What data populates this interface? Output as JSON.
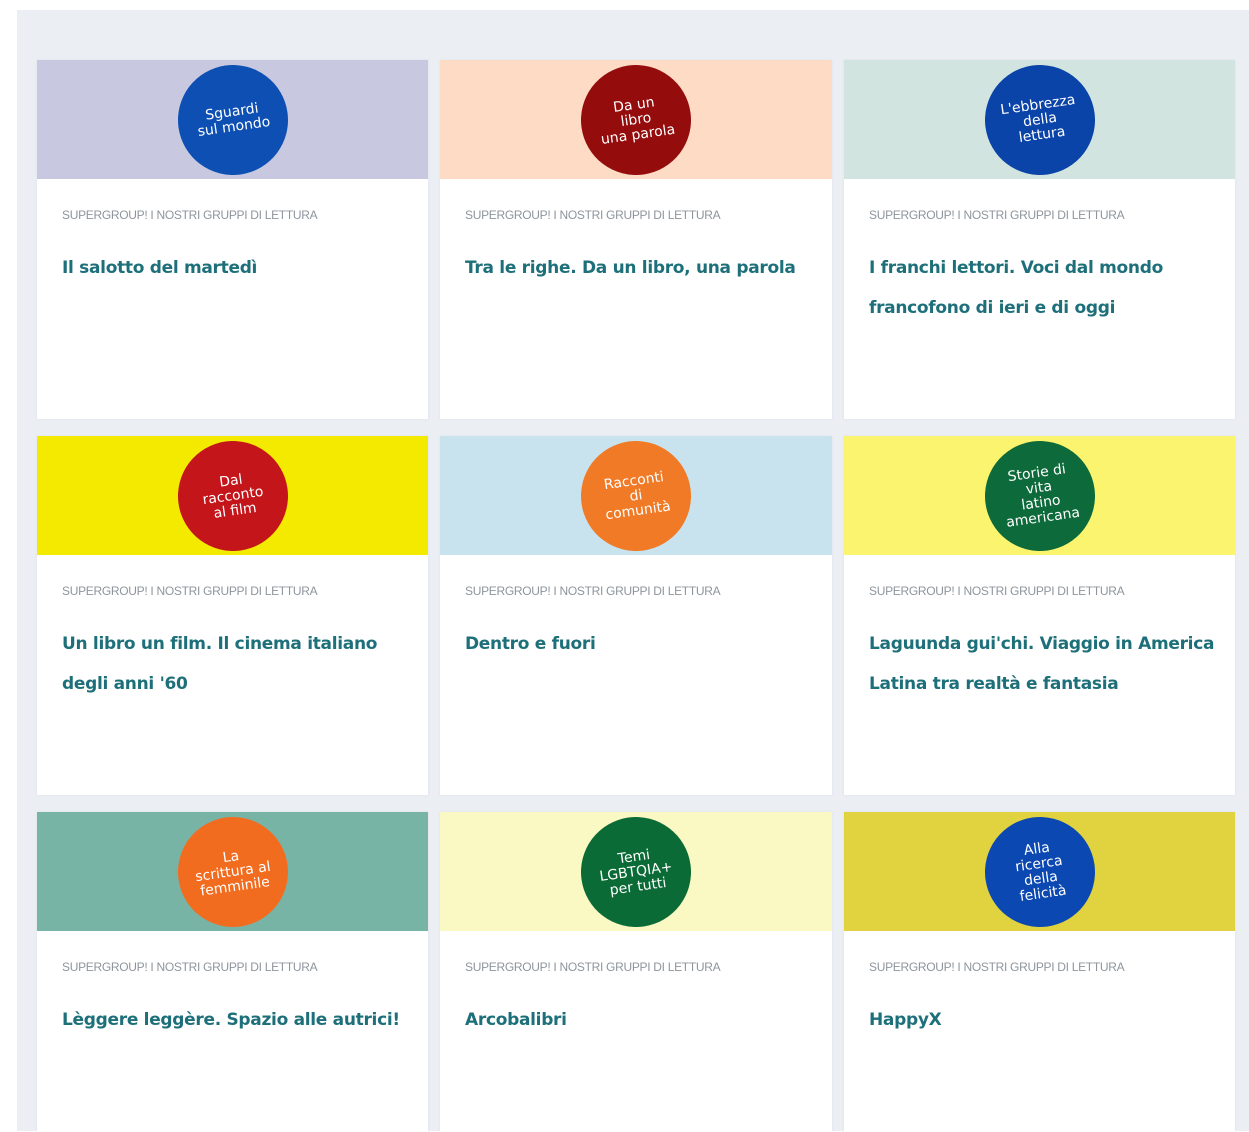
{
  "cards": [
    {
      "category": "SUPERGROUP! I NOSTRI GRUPPI DI LETTURA",
      "title": "Il salotto del martedì",
      "badge_text": "Sguardi\nsul mondo",
      "banner_color": "#c8c8e0",
      "badge_color": "#0e4fb3"
    },
    {
      "category": "SUPERGROUP! I NOSTRI GRUPPI DI LETTURA",
      "title": "Tra le righe. Da un libro, una parola",
      "badge_text": "Da un\nlibro\nuna parola",
      "banner_color": "#fedbc4",
      "badge_color": "#940c0c"
    },
    {
      "category": "SUPERGROUP! I NOSTRI GRUPPI DI LETTURA",
      "title": "I franchi lettori. Voci dal mondo francofono di ieri e di oggi",
      "badge_text": "L'ebbrezza\ndella\nlettura",
      "banner_color": "#d2e4df",
      "badge_color": "#0a44a8"
    },
    {
      "category": "SUPERGROUP! I NOSTRI GRUPPI DI LETTURA",
      "title": "Un libro un film. Il cinema italiano degli anni '60",
      "badge_text": "Dal\nracconto\nal film",
      "banner_color": "#f4ea00",
      "badge_color": "#c4151b"
    },
    {
      "category": "SUPERGROUP! I NOSTRI GRUPPI DI LETTURA",
      "title": "Dentro e fuori",
      "badge_text": "Racconti\ndi\ncomunità",
      "banner_color": "#c8e2ee",
      "badge_color": "#f07a26"
    },
    {
      "category": "SUPERGROUP! I NOSTRI GRUPPI DI LETTURA",
      "title": "Laguunda gui'chi. Viaggio in America Latina tra realtà e fantasia",
      "badge_text": "Storie di\nvita\nlatino\namericana",
      "banner_color": "#faf46e",
      "badge_color": "#0d6a3a"
    },
    {
      "category": "SUPERGROUP! I NOSTRI GRUPPI DI LETTURA",
      "title": "Lèggere leggère. Spazio alle autrici!",
      "badge_text": "La\nscrittura al\nfemminile",
      "banner_color": "#78b4a6",
      "badge_color": "#f26c1f"
    },
    {
      "category": "SUPERGROUP! I NOSTRI GRUPPI DI LETTURA",
      "title": "Arcobalibri",
      "badge_text": "Temi\nLGBTQIA+\nper tutti",
      "banner_color": "#fbf9c3",
      "badge_color": "#0b6b36"
    },
    {
      "category": "SUPERGROUP! I NOSTRI GRUPPI DI LETTURA",
      "title": "HappyX",
      "badge_text": "Alla\nricerca\ndella\nfelicità",
      "banner_color": "#e1d33f",
      "badge_color": "#0c48b1"
    }
  ]
}
